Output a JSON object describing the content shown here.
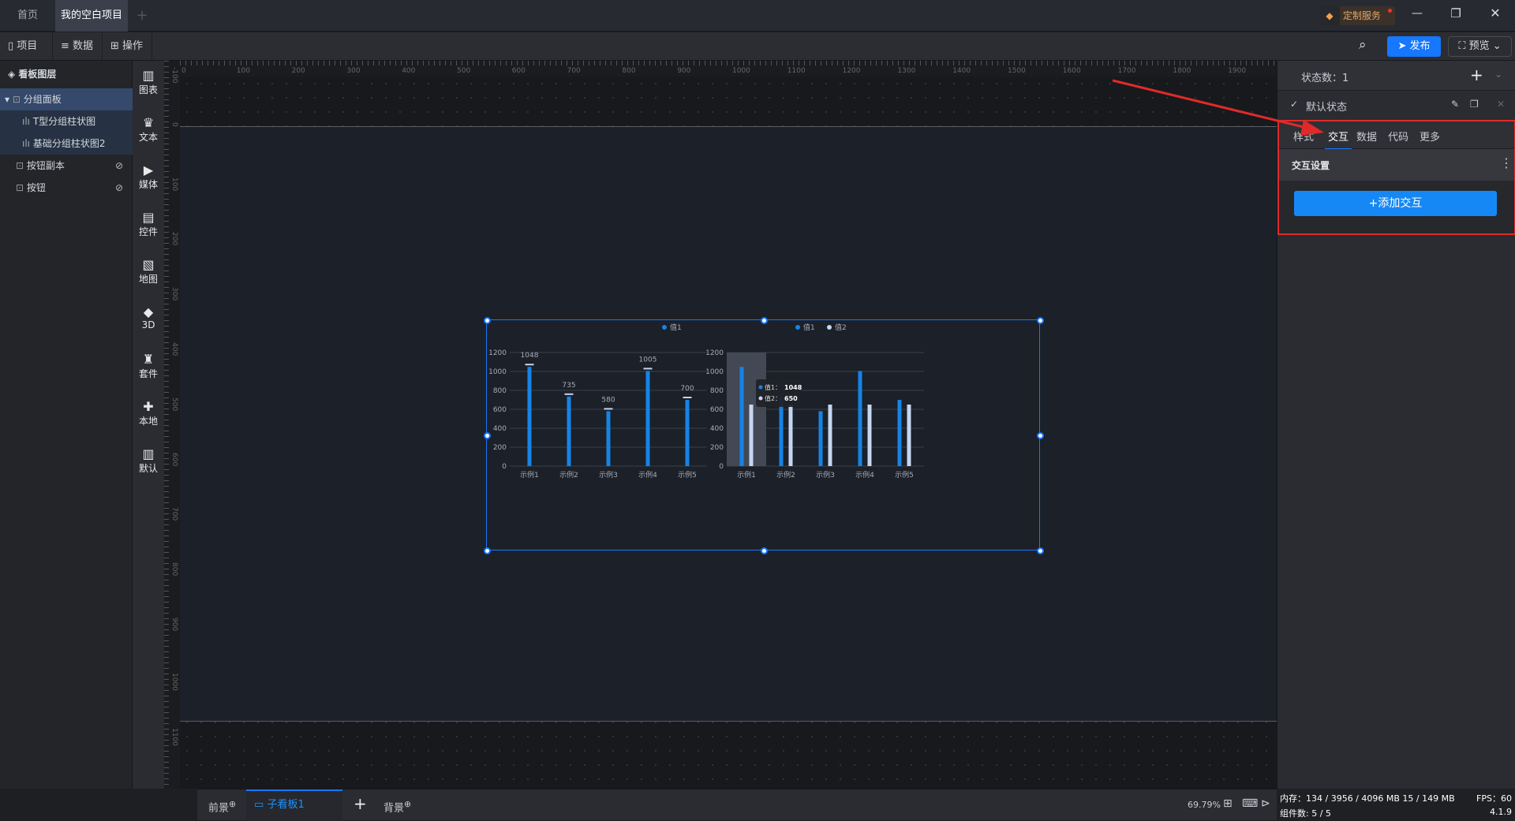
{
  "titlebar": {
    "tabs": [
      {
        "label": "首页"
      },
      {
        "label": "我的空白项目",
        "unsaved": true
      }
    ],
    "add_tab": "+",
    "service": "定制服务"
  },
  "toolbar": {
    "menus": [
      "项目",
      "数据",
      "操作"
    ],
    "publish": "发布",
    "preview": "预览"
  },
  "layers": {
    "title": "看板图层",
    "items": [
      {
        "label": "分组面板"
      },
      {
        "label": "T型分组柱状图"
      },
      {
        "label": "基础分组柱状图2"
      },
      {
        "label": "按钮副本"
      },
      {
        "label": "按钮"
      }
    ]
  },
  "iconbar": [
    {
      "label": "图表",
      "icon": "bar-chart-icon",
      "g": "▥"
    },
    {
      "label": "文本",
      "icon": "crown-icon",
      "g": "♛"
    },
    {
      "label": "媒体",
      "icon": "media-icon",
      "g": "▶"
    },
    {
      "label": "控件",
      "icon": "widget-icon",
      "g": "▤"
    },
    {
      "label": "地图",
      "icon": "map-icon",
      "g": "▧"
    },
    {
      "label": "3D",
      "icon": "cube-icon",
      "g": "◆"
    },
    {
      "label": "套件",
      "icon": "shirt-icon",
      "g": "♜"
    },
    {
      "label": "本地",
      "icon": "puzzle-icon",
      "g": "✚"
    },
    {
      "label": "默认",
      "icon": "bar-chart-icon",
      "g": "▥"
    }
  ],
  "ruler": {
    "h_ticks": [
      "0",
      "100",
      "200",
      "300",
      "400",
      "500",
      "600",
      "700",
      "800",
      "900",
      "1000",
      "1100",
      "1200",
      "1300",
      "1400",
      "1500",
      "1600",
      "1700",
      "1800",
      "1900"
    ],
    "v_ticks": [
      "-100",
      "0",
      "100",
      "200",
      "300",
      "400",
      "500",
      "600",
      "700",
      "800",
      "900",
      "1000",
      "1100"
    ]
  },
  "right_panel": {
    "state_count": "状态数：1",
    "default_state": "默认状态",
    "tabs": [
      "样式",
      "交互",
      "数据",
      "代码",
      "更多"
    ],
    "active_tab": 1,
    "section": "交互设置",
    "add_button": "+添加交互"
  },
  "bottombar": {
    "foreground": "前景",
    "subboard": "子看板1",
    "background": "背景",
    "zoom": "69.79%"
  },
  "status": {
    "memory": "内存：134 / 3956 / 4096 MB  15 / 149 MB",
    "fps": "FPS：60",
    "components": "组件数: 5 / 5",
    "version": "4.1.9"
  },
  "colors": {
    "accent": "#1677ff",
    "bar1": "#1584e6",
    "bar2": "#c5d6f2",
    "highlight": "#e03030"
  },
  "chart_data": [
    {
      "type": "bar",
      "title": "T型分组柱状图",
      "categories": [
        "示例1",
        "示例2",
        "示例3",
        "示例4",
        "示例5"
      ],
      "series": [
        {
          "name": "值1",
          "values": [
            1048,
            735,
            580,
            1005,
            700
          ]
        }
      ],
      "ylim": [
        0,
        1200
      ],
      "yticks": [
        "0",
        "200",
        "400",
        "600",
        "800",
        "1000",
        "1200"
      ],
      "legend": "top-right",
      "data_labels": true
    },
    {
      "type": "bar",
      "title": "基础分组柱状图2",
      "categories": [
        "示例1",
        "示例2",
        "示例3",
        "示例4",
        "示例5"
      ],
      "series": [
        {
          "name": "值1",
          "values": [
            1048,
            735,
            580,
            1005,
            700
          ]
        },
        {
          "name": "值2",
          "values": [
            650,
            650,
            650,
            650,
            650
          ]
        }
      ],
      "ylim": [
        0,
        1200
      ],
      "yticks": [
        "0",
        "200",
        "400",
        "600",
        "800",
        "1000",
        "1200"
      ],
      "legend": "top-right",
      "tooltip": {
        "category": "示例1",
        "lines": [
          {
            "name": "值1：",
            "value": "1048"
          },
          {
            "name": "值2：",
            "value": "650"
          }
        ]
      }
    }
  ]
}
